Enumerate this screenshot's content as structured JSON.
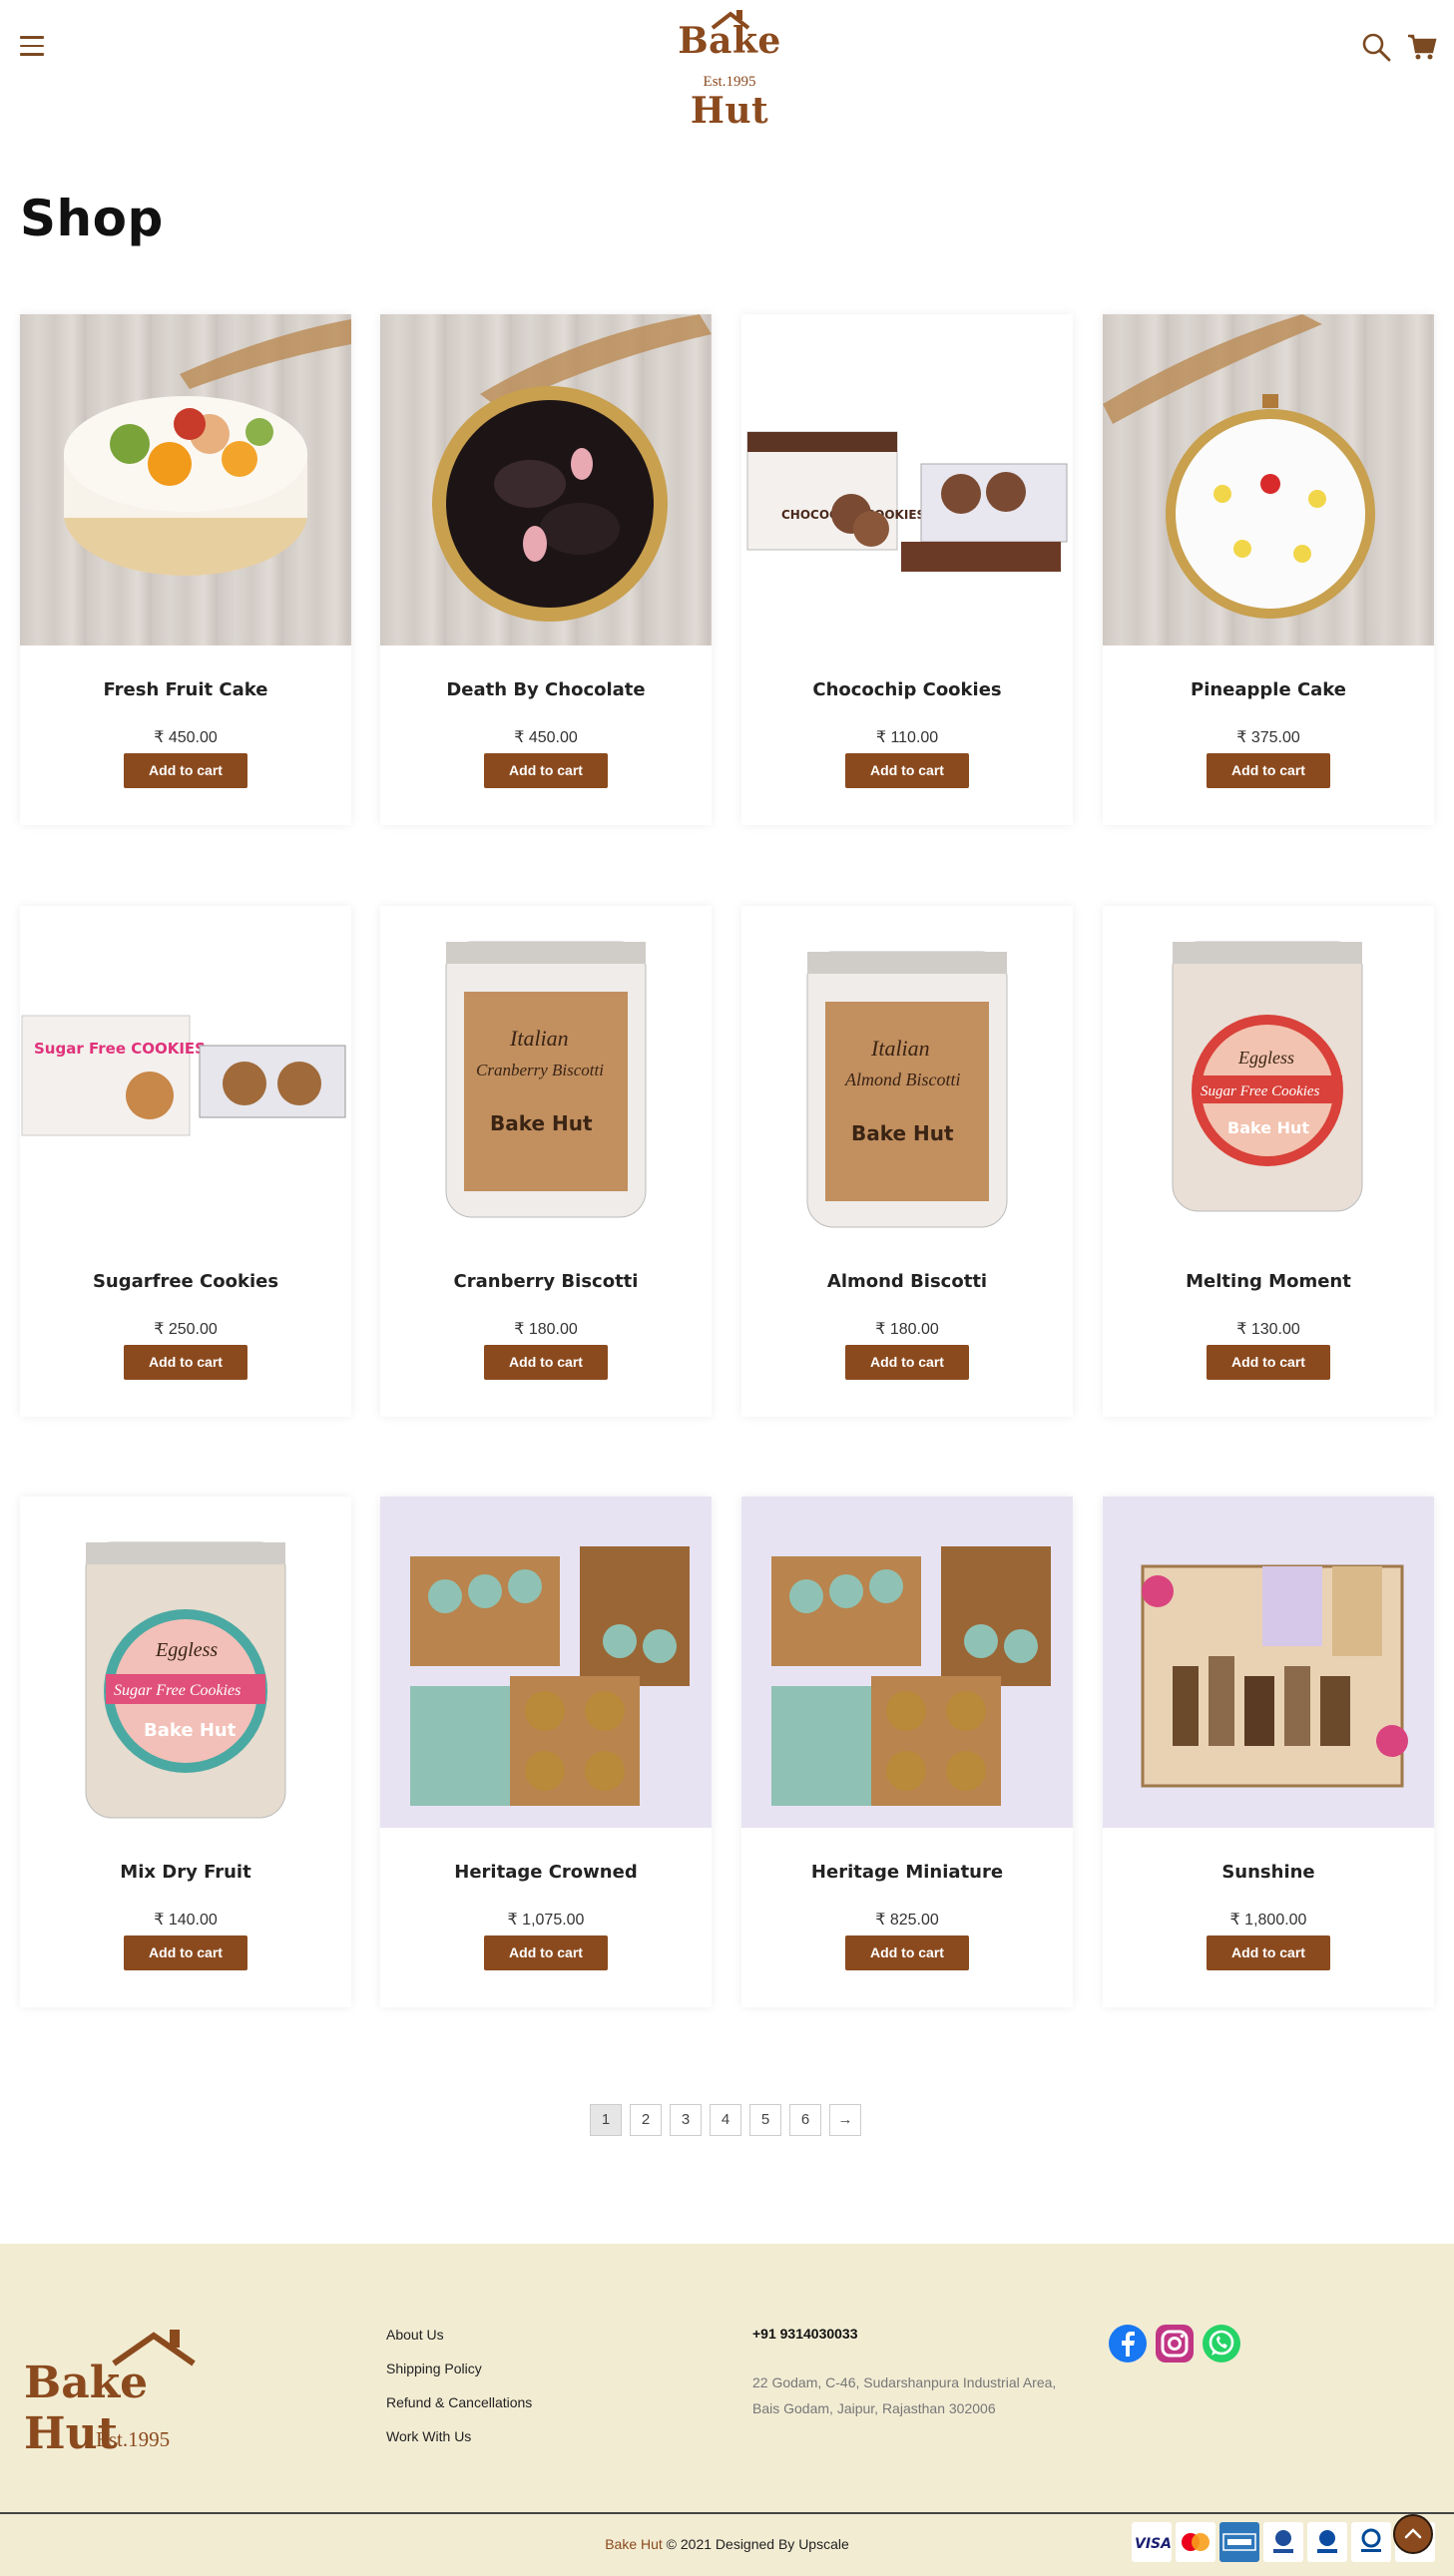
{
  "header": {
    "menu_icon": "hamburger-icon",
    "logo_text": "Bake Hut",
    "logo_est": "Est.1995",
    "search_icon": "search-icon",
    "cart_icon": "cart-icon"
  },
  "page_title": "Shop",
  "products": [
    {
      "name": "Fresh Fruit Cake",
      "price": "₹ 450.00",
      "button": "Add to cart"
    },
    {
      "name": "Death By Chocolate",
      "price": "₹ 450.00",
      "button": "Add to cart"
    },
    {
      "name": "Chocochip Cookies",
      "price": "₹ 110.00",
      "button": "Add to cart"
    },
    {
      "name": "Pineapple Cake",
      "price": "₹ 375.00",
      "button": "Add to cart"
    },
    {
      "name": "Sugarfree Cookies",
      "price": "₹ 250.00",
      "button": "Add to cart"
    },
    {
      "name": "Cranberry Biscotti",
      "price": "₹ 180.00",
      "button": "Add to cart"
    },
    {
      "name": "Almond Biscotti",
      "price": "₹ 180.00",
      "button": "Add to cart"
    },
    {
      "name": "Melting Moment",
      "price": "₹ 130.00",
      "button": "Add to cart"
    },
    {
      "name": "Mix Dry Fruit",
      "price": "₹ 140.00",
      "button": "Add to cart"
    },
    {
      "name": "Heritage Crowned",
      "price": "₹ 1,075.00",
      "button": "Add to cart"
    },
    {
      "name": "Heritage Miniature",
      "price": "₹ 825.00",
      "button": "Add to cart"
    },
    {
      "name": "Sunshine",
      "price": "₹ 1,800.00",
      "button": "Add to cart"
    }
  ],
  "product_images": {
    "cookie_box": "CHOCOCHIP COOKIES",
    "sugarfree_box": "Sugar Free COOKIES",
    "jar_italian": "Italian",
    "jar_cranberry": "Cranberry Biscotti",
    "jar_almond": "Almond Biscotti",
    "jar_eggless": "Eggless",
    "jar_sugarfree": "Sugar Free Cookies",
    "jar_brand": "Bake Hut"
  },
  "pagination": {
    "pages": [
      "1",
      "2",
      "3",
      "4",
      "5",
      "6"
    ],
    "next": "→",
    "active_page": "1"
  },
  "footer": {
    "logo_text": "Bake Hut",
    "logo_est": "Est.1995",
    "links": [
      "About Us",
      "Shipping Policy",
      "Refund & Cancellations",
      "Work With Us"
    ],
    "phone": "+91 9314030033",
    "address_line1": "22 Godam, C-46, Sudarshanpura Industrial Area,",
    "address_line2": "Bais Godam, Jaipur, Rajasthan 302006",
    "social": [
      "facebook-icon",
      "instagram-icon",
      "whatsapp-icon"
    ],
    "copyright_brand": "Bake Hut",
    "copyright_rest": " © 2021 Designed By Upscale",
    "payment_methods": [
      "VISA",
      "Mastercard",
      "American Express",
      "RuPay",
      "Bajaj",
      "Diners Club",
      "Maestro"
    ]
  },
  "colors": {
    "brand": "#8b4a1e",
    "footer_bg": "#f2ecd3"
  }
}
